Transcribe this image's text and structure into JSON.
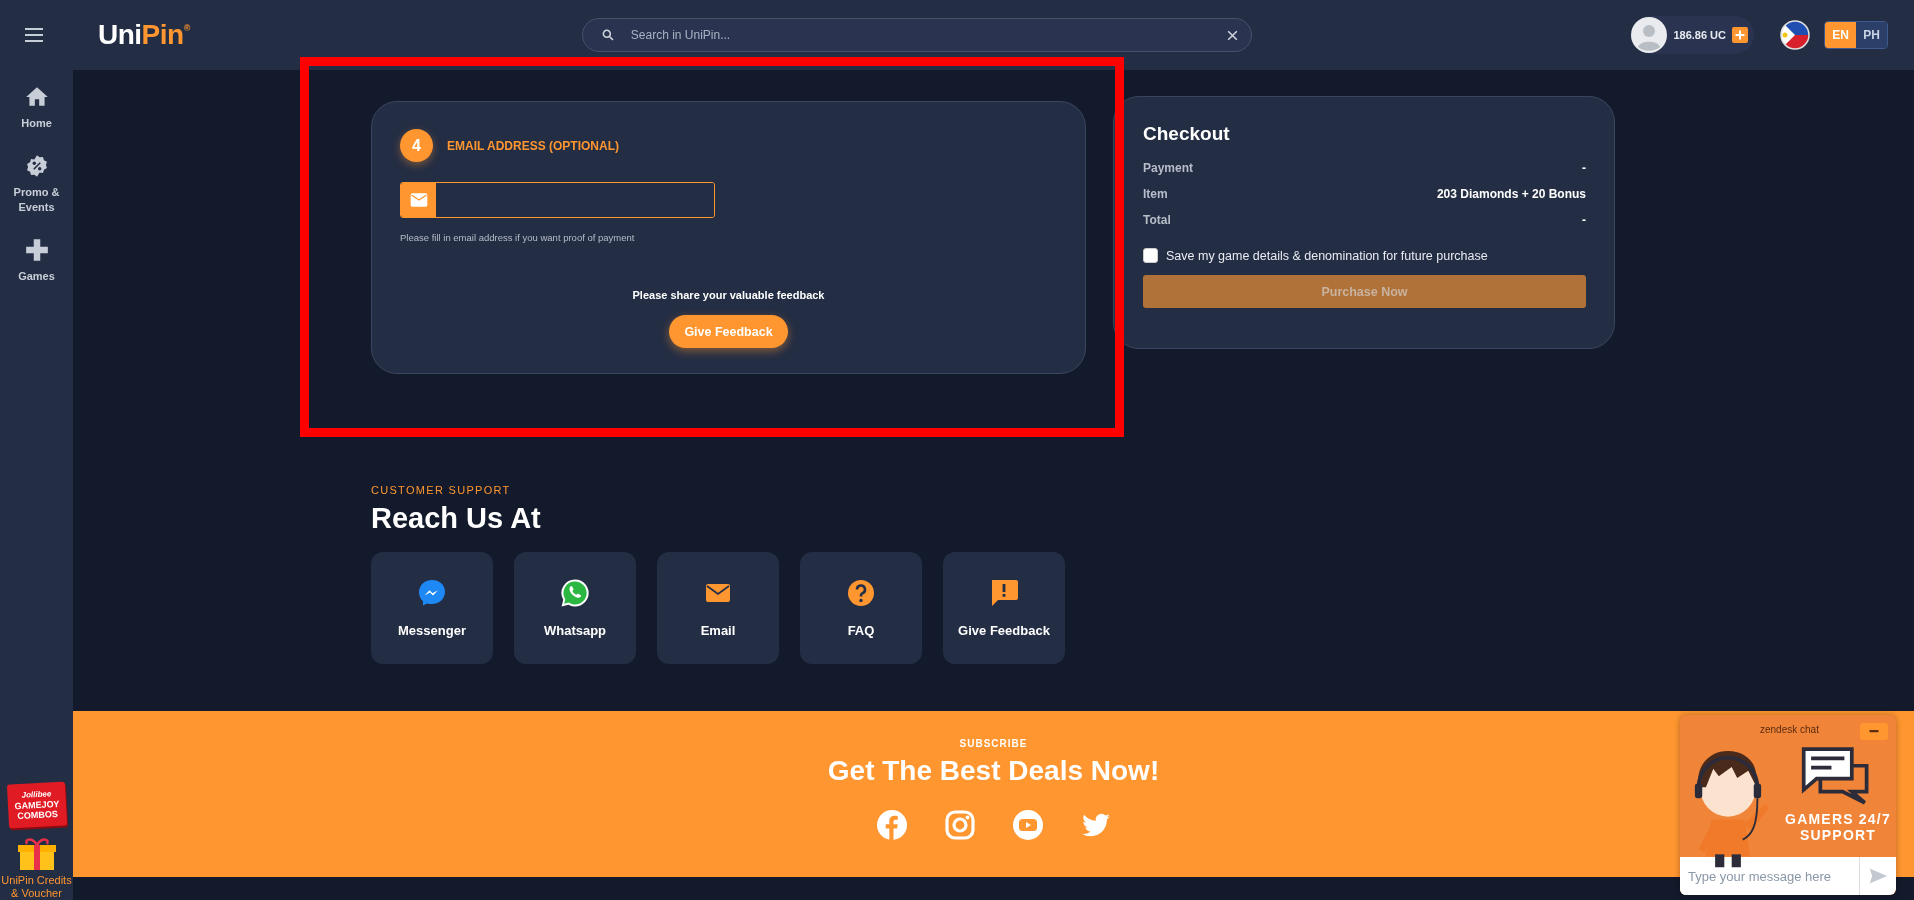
{
  "topbar": {
    "logo_parts": [
      {
        "text": "Uni",
        "accent": false
      },
      {
        "text": "Pin",
        "accent": true
      }
    ],
    "trademark": "®",
    "search": {
      "placeholder": "Search in UniPin..."
    },
    "balance": "186.86 UC",
    "languages": [
      {
        "label": "EN",
        "selected": true
      },
      {
        "label": "PH",
        "selected": false
      }
    ]
  },
  "sidebar": {
    "items": [
      {
        "label": "Home",
        "kind": "home"
      },
      {
        "label": "Promo & Events",
        "kind": "promo"
      },
      {
        "label": "Games",
        "kind": "games"
      }
    ],
    "promo_badge": {
      "lines": [
        "Jollibee",
        "GAMEJOY",
        "COMBOS"
      ]
    },
    "credits": {
      "label": "UniPin Credits & Voucher"
    }
  },
  "email_step": {
    "step": "4",
    "title": "EMAIL ADDRESS (OPTIONAL)",
    "hint": "Please fill in email address if you want proof of payment",
    "feedback_prompt": "Please share your valuable feedback",
    "feedback_button": "Give Feedback"
  },
  "checkout": {
    "title": "Checkout",
    "rows": [
      {
        "label": "Payment",
        "value": "-"
      },
      {
        "label": "Item",
        "value": "203 Diamonds + 20 Bonus"
      },
      {
        "label": "Total",
        "value": "-"
      }
    ],
    "save_option": {
      "label": "Save my game details & denomination for future purchase",
      "checked": false
    },
    "purchase_button": {
      "label": "Purchase Now",
      "disabled": true
    }
  },
  "support": {
    "eyebrow": "CUSTOMER SUPPORT",
    "title": "Reach Us At",
    "channels": [
      {
        "label": "Messenger",
        "kind": "messenger"
      },
      {
        "label": "Whatsapp",
        "kind": "whatsapp"
      },
      {
        "label": "Email",
        "kind": "email"
      },
      {
        "label": "FAQ",
        "kind": "faq"
      },
      {
        "label": "Give Feedback",
        "kind": "feedback"
      }
    ]
  },
  "subscribe": {
    "eyebrow": "SUBSCRIBE",
    "title": "Get The Best Deals Now!",
    "socials": [
      {
        "kind": "facebook"
      },
      {
        "kind": "instagram"
      },
      {
        "kind": "youtube"
      },
      {
        "kind": "twitter"
      }
    ]
  },
  "chat_widget": {
    "brand": "zendesk chat",
    "banner_lines": [
      "GAMERS 24/7",
      "SUPPORT"
    ],
    "placeholder": "Type your message here"
  },
  "highlight_frame": true
}
